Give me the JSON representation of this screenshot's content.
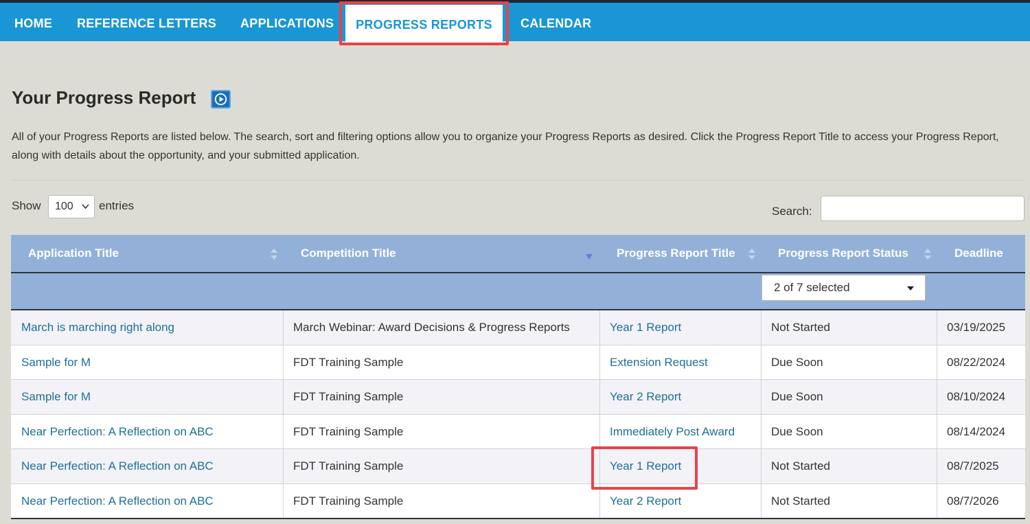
{
  "nav": {
    "items": [
      {
        "label": "HOME"
      },
      {
        "label": "REFERENCE LETTERS"
      },
      {
        "label": "APPLICATIONS"
      },
      {
        "label": "PROGRESS REPORTS",
        "active": true
      },
      {
        "label": "CALENDAR"
      }
    ]
  },
  "page": {
    "title": "Your Progress Report",
    "intro": "All of your Progress Reports are listed below. The search, sort and filtering options allow you to organize your Progress Reports as desired. Click the Progress Report Title to access your Progress Report, along with details about the opportunity, and your submitted application."
  },
  "controls": {
    "show_label": "Show",
    "entries_value": "100",
    "entries_label": "entries",
    "search_label": "Search:",
    "search_value": ""
  },
  "table": {
    "headers": [
      "Application Title",
      "Competition Title",
      "Progress Report Title",
      "Progress Report Status",
      "Deadline"
    ],
    "status_filter": "2 of 7 selected",
    "rows": [
      [
        "March is marching right along",
        "March Webinar: Award Decisions & Progress Reports",
        "Year 1 Report",
        "Not Started",
        "03/19/2025"
      ],
      [
        "Sample for M",
        "FDT Training Sample",
        "Extension Request",
        "Due Soon",
        "08/22/2024"
      ],
      [
        "Sample for M",
        "FDT Training Sample",
        "Year 2 Report",
        "Due Soon",
        "08/10/2024"
      ],
      [
        "Near Perfection: A Reflection on ABC",
        "FDT Training Sample",
        "Immediately Post Award",
        "Due Soon",
        "08/14/2024"
      ],
      [
        "Near Perfection: A Reflection on ABC",
        "FDT Training Sample",
        "Year 1 Report",
        "Not Started",
        "08/7/2025"
      ],
      [
        "Near Perfection: A Reflection on ABC",
        "FDT Training Sample",
        "Year 2 Report",
        "Not Started",
        "08/7/2026"
      ]
    ]
  },
  "colors": {
    "nav_bg": "#1a96d4",
    "header_bg": "#93b1d8",
    "link": "#1f6f95",
    "highlight": "#e8424a"
  }
}
